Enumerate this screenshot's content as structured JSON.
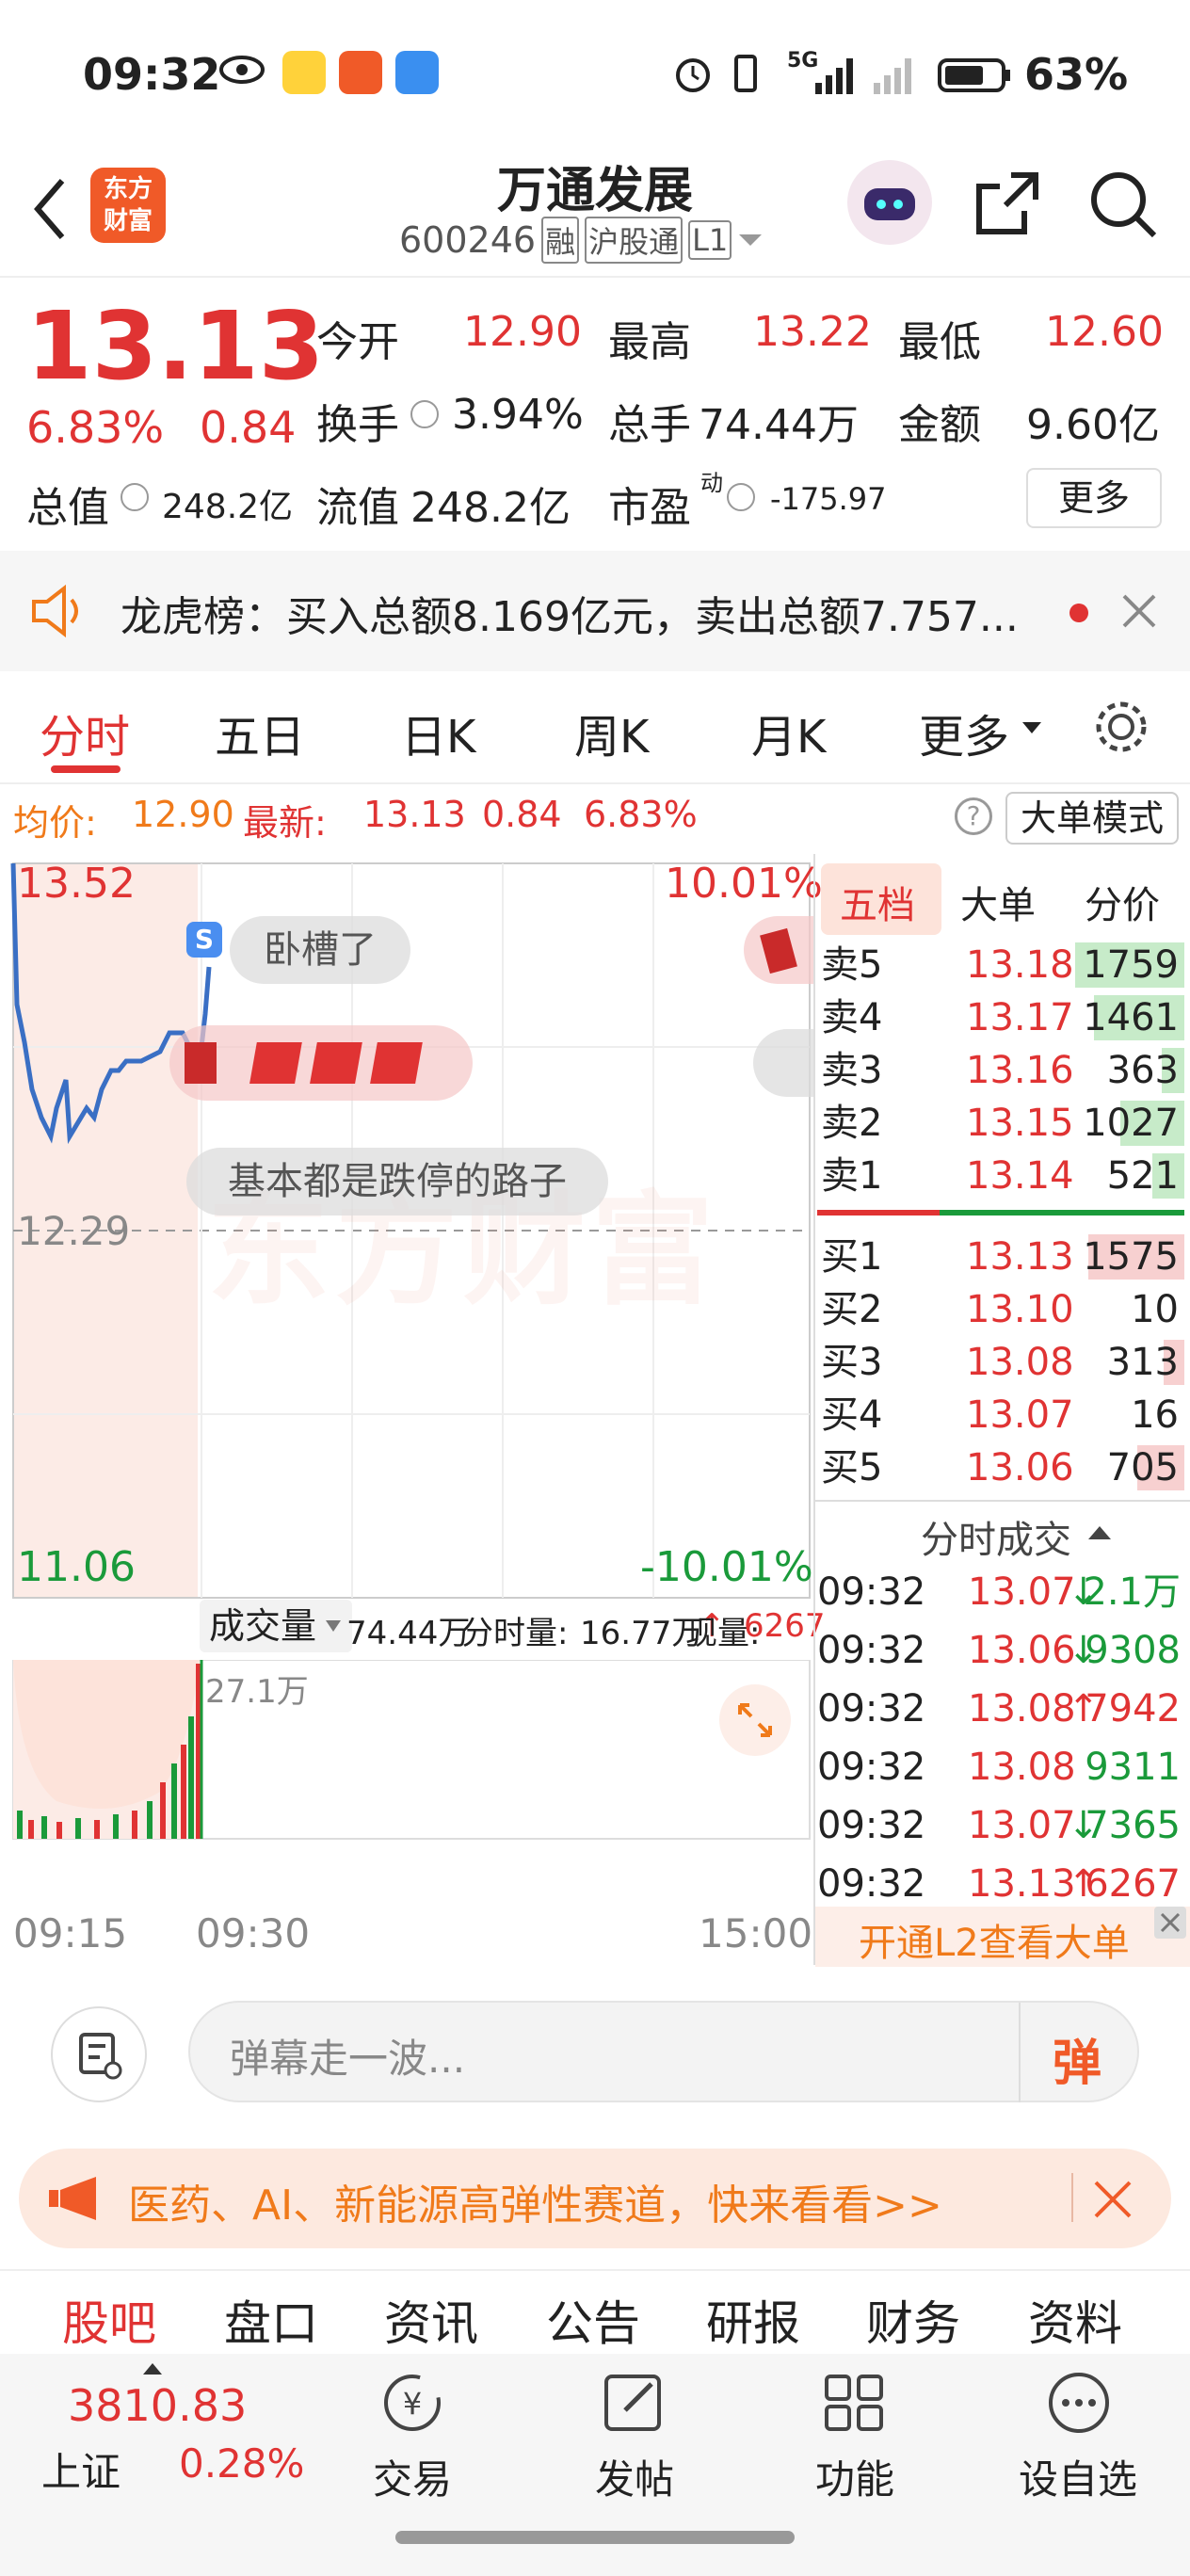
{
  "status": {
    "time": "09:32",
    "battery": "63%",
    "network": "5G"
  },
  "header": {
    "title": "万通发展",
    "code": "600246",
    "tags": [
      "融",
      "沪股通",
      "L1"
    ]
  },
  "quote": {
    "price": "13.13",
    "change_pct": "6.83%",
    "change": "0.84",
    "open_label": "今开",
    "open": "12.90",
    "high_label": "最高",
    "high": "13.22",
    "low_label": "最低",
    "low": "12.60",
    "turnover_label": "换手",
    "turnover": "3.94%",
    "volume_label": "总手",
    "volume": "74.44万",
    "amount_label": "金额",
    "amount": "9.60亿",
    "mktcap_label": "总值",
    "mktcap": "248.2亿",
    "float_label": "流值",
    "float": "248.2亿",
    "pe_label": "市盈",
    "pe_sup": "动",
    "pe": "-175.97",
    "more": "更多"
  },
  "notice": {
    "text": "龙虎榜：买入总额8.169亿元，卖出总额7.757..."
  },
  "tabs": [
    "分时",
    "五日",
    "日K",
    "周K",
    "月K",
    "更多"
  ],
  "infobar": {
    "avg_label": "均价:",
    "avg": "12.90",
    "latest_label": "最新:",
    "latest": "13.13",
    "chg": "0.84",
    "pct": "6.83%",
    "mode": "大单模式"
  },
  "chart": {
    "ymax": "13.52",
    "ymax_pct": "10.01%",
    "ymid": "12.29",
    "ymin": "11.06",
    "ymin_pct": "-10.01%",
    "watermark": "东方财富",
    "danmu": [
      "卧槽了",
      "基本都是跌停的路子"
    ],
    "vol_label": "成交量",
    "vol_total": "74.44万",
    "vol_now_label": "分时量:",
    "vol_now": "16.77万",
    "vol_cur_label": "现量:",
    "vol_cur": "6267",
    "vol_max": "27.1万",
    "x_labels": [
      "09:15",
      "09:30",
      "15:00"
    ]
  },
  "chart_data": {
    "type": "line",
    "x": [
      "09:15",
      "09:30",
      "09:31",
      "09:32"
    ],
    "ylim": [
      11.06,
      13.52
    ],
    "prev_close": 12.29
  },
  "orderbook": {
    "tabs": [
      "五档",
      "大单",
      "分价"
    ],
    "asks": [
      {
        "l": "卖5",
        "p": "13.18",
        "v": "1759"
      },
      {
        "l": "卖4",
        "p": "13.17",
        "v": "1461"
      },
      {
        "l": "卖3",
        "p": "13.16",
        "v": "363"
      },
      {
        "l": "卖2",
        "p": "13.15",
        "v": "1027"
      },
      {
        "l": "卖1",
        "p": "13.14",
        "v": "521"
      }
    ],
    "bids": [
      {
        "l": "买1",
        "p": "13.13",
        "v": "1575"
      },
      {
        "l": "买2",
        "p": "13.10",
        "v": "10"
      },
      {
        "l": "买3",
        "p": "13.08",
        "v": "313"
      },
      {
        "l": "买4",
        "p": "13.07",
        "v": "16"
      },
      {
        "l": "买5",
        "p": "13.06",
        "v": "705"
      }
    ],
    "trades_title": "分时成交",
    "trades": [
      {
        "t": "09:32",
        "p": "13.07",
        "v": "2.1万",
        "d": "down"
      },
      {
        "t": "09:32",
        "p": "13.06",
        "v": "9308",
        "d": "down"
      },
      {
        "t": "09:32",
        "p": "13.08",
        "v": "7942",
        "d": "up"
      },
      {
        "t": "09:32",
        "p": "13.08",
        "v": "9311",
        "d": "none"
      },
      {
        "t": "09:32",
        "p": "13.07",
        "v": "7365",
        "d": "down"
      },
      {
        "t": "09:32",
        "p": "13.13",
        "v": "6267",
        "d": "up"
      }
    ],
    "l2": "开通L2查看大单"
  },
  "danmu_input": {
    "placeholder": "弹幕走一波...",
    "btn": "弹"
  },
  "promo": {
    "text": "医药、AI、新能源高弹性赛道，快来看看>>"
  },
  "section_tabs": [
    "股吧",
    "盘口",
    "资讯",
    "公告",
    "研报",
    "财务",
    "资料"
  ],
  "bottom": {
    "index_value": "3810.83",
    "index_name": "上证",
    "index_pct": "0.28%",
    "items": [
      "交易",
      "发帖",
      "功能",
      "设自选"
    ]
  }
}
